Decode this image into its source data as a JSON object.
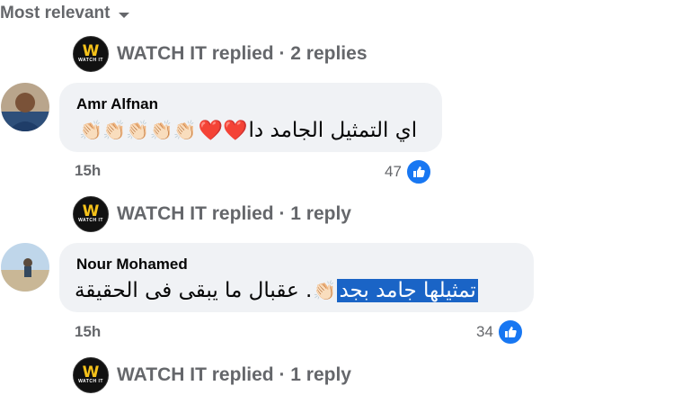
{
  "sort_label": "Most relevant",
  "reply_logo": {
    "big": "W",
    "small": "WATCH IT"
  },
  "replies": [
    {
      "text": "WATCH IT replied · 2 replies"
    },
    {
      "text": "WATCH IT replied · 1 reply"
    },
    {
      "text": "WATCH IT replied · 1 reply"
    }
  ],
  "comments": [
    {
      "author": "Amr Alfnan",
      "text": "اي التمثيل الجامد دا",
      "emoji_hearts": "❤️❤️",
      "emoji_claps": "👏🏻👏🏻👏🏻👏🏻👏🏻",
      "time": "15h",
      "reactions": "47"
    },
    {
      "author": "Nour Mohamed",
      "text_highlighted": "تمثيلها جامد بجد",
      "emoji_clap": "👏🏻",
      "text_rest": ". عقبال ما يبقى فى الحقيقة",
      "time": "15h",
      "reactions": "34"
    }
  ],
  "colors": {
    "accent": "#1877f2",
    "bubble": "#f0f2f5",
    "muted": "#65676b",
    "heart": "#e0242b",
    "highlight": "#1a64c6"
  }
}
